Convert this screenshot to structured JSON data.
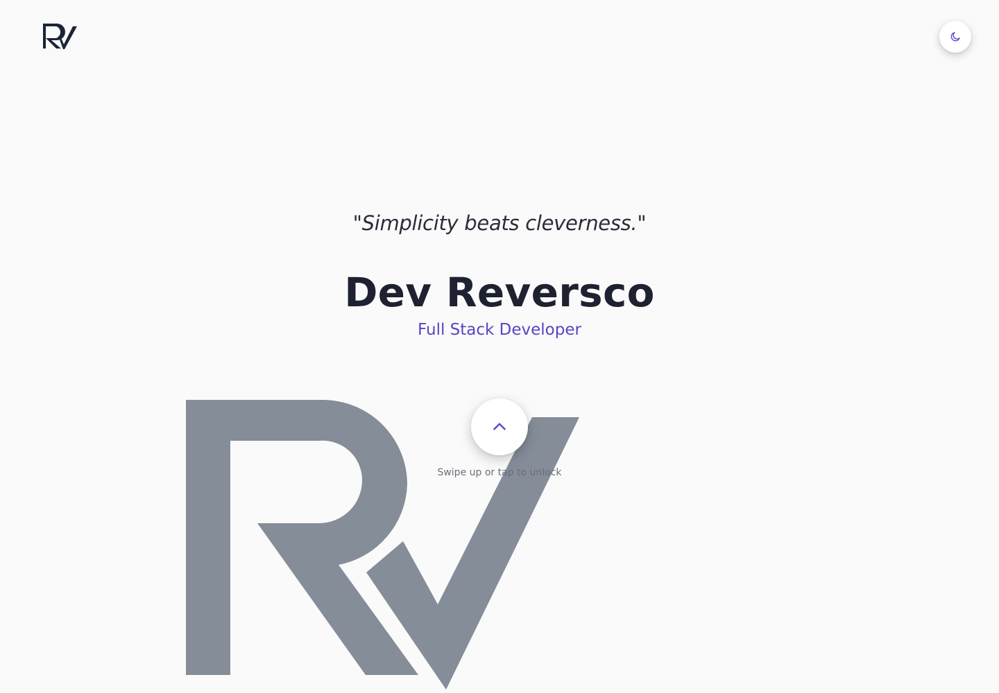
{
  "header": {
    "logo_icon": "rv-monogram-logo",
    "theme_toggle_icon": "moon-icon"
  },
  "hero": {
    "quote": "\"Simplicity beats cleverness.\"",
    "name": "Dev Reversco",
    "role": "Full Stack Developer"
  },
  "unlock": {
    "icon": "chevron-up-icon",
    "hint": "Swipe up or tap to unlock"
  },
  "colors": {
    "background": "#fafafa",
    "text_dark": "#1e2130",
    "accent": "#5546c4",
    "logo_dark": "#1b2536",
    "watermark": "#858d99"
  }
}
